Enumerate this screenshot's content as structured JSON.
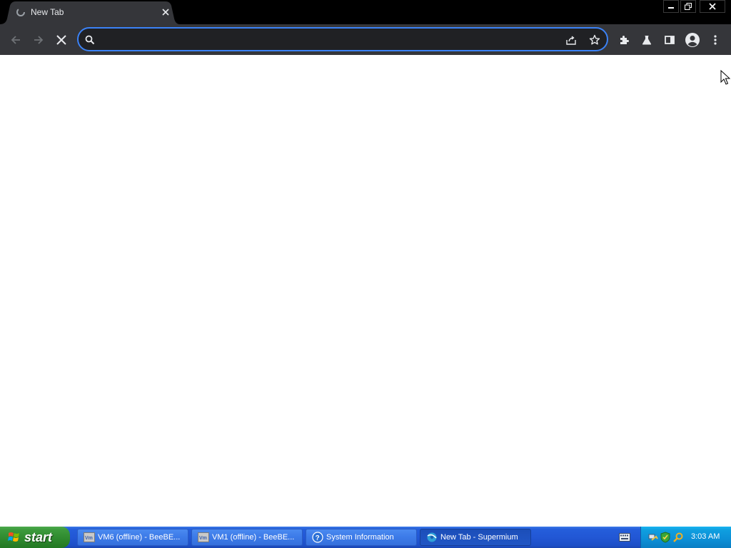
{
  "tab": {
    "title": "New Tab"
  },
  "window": {
    "title": "New Tab - Supermium"
  },
  "omnibox": {
    "value": "",
    "placeholder": ""
  },
  "taskbar": {
    "start_label": "start",
    "tasks": [
      {
        "label": "VM6 (offline) - BeeBE...",
        "icon": "vm-icon"
      },
      {
        "label": "VM1 (offline) - BeeBE...",
        "icon": "vm-icon"
      },
      {
        "label": "System Information",
        "icon": "help-icon"
      },
      {
        "label": "New Tab - Supermium",
        "icon": "browser-icon",
        "active": true
      }
    ],
    "clock": "3:03 AM"
  },
  "colors": {
    "focus_ring": "#3b82f6",
    "toolbar_bg": "#35363a",
    "tabstrip_bg": "#000000",
    "taskbar_blue": "#245edb",
    "start_green": "#3c9a3c",
    "tray_blue": "#0c8fd6"
  }
}
